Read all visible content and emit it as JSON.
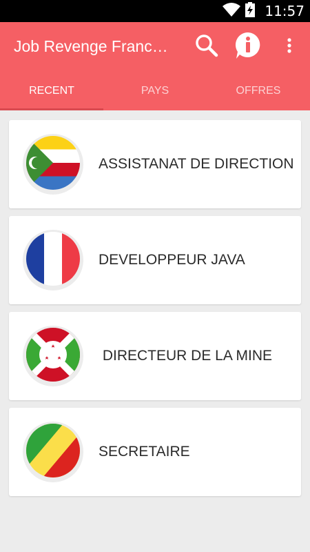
{
  "status_bar": {
    "time": "11:57",
    "icons": [
      "wifi-icon",
      "battery-charging-icon"
    ]
  },
  "app_bar": {
    "title": "Job Revenge Franc…",
    "color": "#f55f64",
    "actions": [
      "search-icon",
      "info-icon",
      "overflow-menu-icon"
    ]
  },
  "tabs": [
    {
      "label": "RECENT",
      "active": true
    },
    {
      "label": "PAYS",
      "active": false
    },
    {
      "label": "OFFRES",
      "active": false
    }
  ],
  "jobs": [
    {
      "title": "ASSISTANAT DE DIRECTION",
      "flag": "comoros-flag-icon"
    },
    {
      "title": "DEVELOPPEUR JAVA",
      "flag": "france-flag-icon"
    },
    {
      "title": " DIRECTEUR DE LA MINE",
      "flag": "burundi-flag-icon"
    },
    {
      "title": "SECRETAIRE",
      "flag": "congo-flag-icon"
    }
  ]
}
